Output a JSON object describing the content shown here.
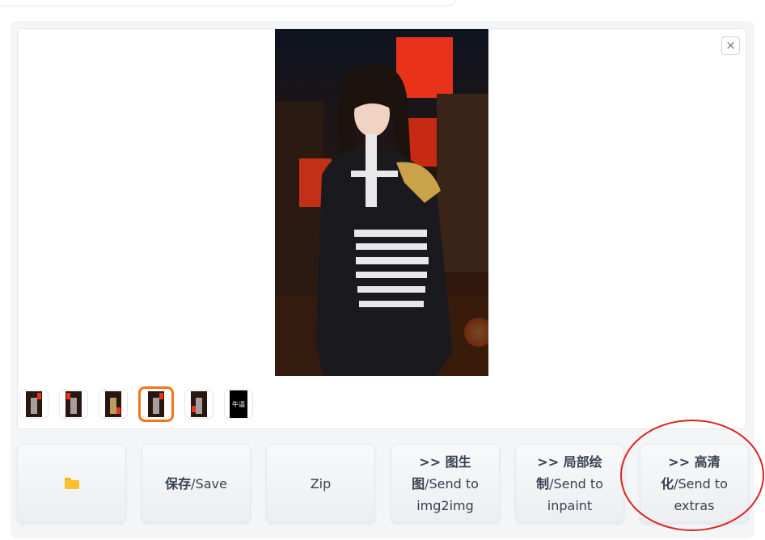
{
  "gallery": {
    "close_label": "×",
    "thumbnails": [
      {
        "label": "",
        "selected": false,
        "style": "artwork"
      },
      {
        "label": "",
        "selected": false,
        "style": "artwork"
      },
      {
        "label": "",
        "selected": false,
        "style": "artwork"
      },
      {
        "label": "",
        "selected": true,
        "style": "artwork"
      },
      {
        "label": "",
        "selected": false,
        "style": "artwork"
      },
      {
        "label": "牛逼",
        "selected": false,
        "style": "black"
      }
    ]
  },
  "actions": {
    "folder_icon": "folder-icon",
    "save_bold": "保存",
    "save_rest": "/Save",
    "zip_label": "Zip",
    "img2img_bold": ">> 图生图",
    "img2img_rest": "/Send to img2img",
    "inpaint_bold": ">> 局部绘制",
    "inpaint_rest": "/Send to inpaint",
    "extras_bold": ">> 高清化",
    "extras_rest": "/Send to extras"
  },
  "colors": {
    "accent": "#f97316",
    "annotation": "#e02020"
  }
}
